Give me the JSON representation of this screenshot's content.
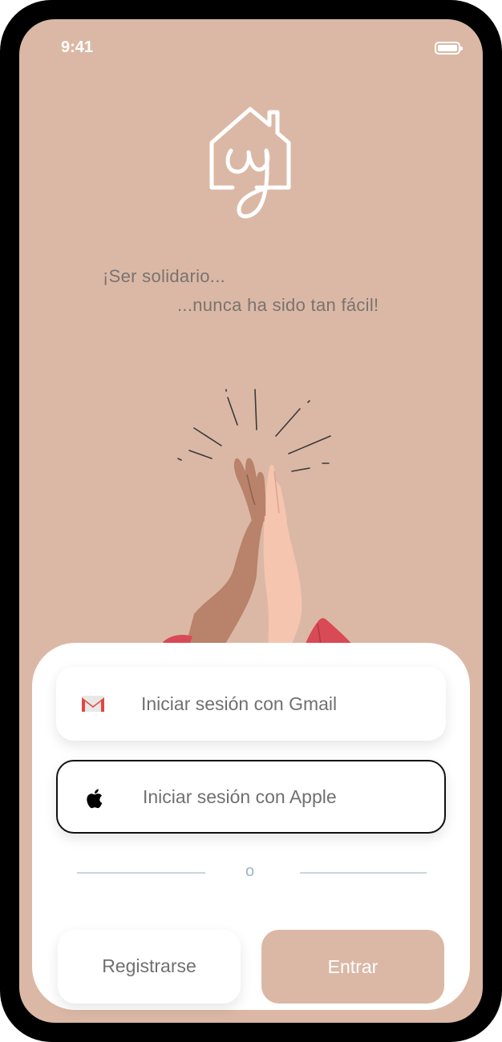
{
  "status_bar": {
    "time": "9:41",
    "battery_icon": "battery-icon"
  },
  "logo": {
    "icon": "house-y-logo-icon"
  },
  "tagline": {
    "line1": "¡Ser solidario...",
    "line2": "...nunca ha sido tan fácil!"
  },
  "illustration": {
    "icon": "high-five-hands-illustration"
  },
  "login": {
    "gmail": {
      "label": "Iniciar sesión con Gmail",
      "icon": "gmail-icon"
    },
    "apple": {
      "label": "Iniciar sesión con Apple",
      "icon": "apple-icon"
    },
    "divider": "o",
    "register_label": "Registrarse",
    "enter_label": "Entrar"
  },
  "colors": {
    "background": "#dbb8a5",
    "sheet": "#ffffff",
    "text_muted": "#707070",
    "divider": "#c9d6da",
    "gmail_red": "#e4473c"
  }
}
